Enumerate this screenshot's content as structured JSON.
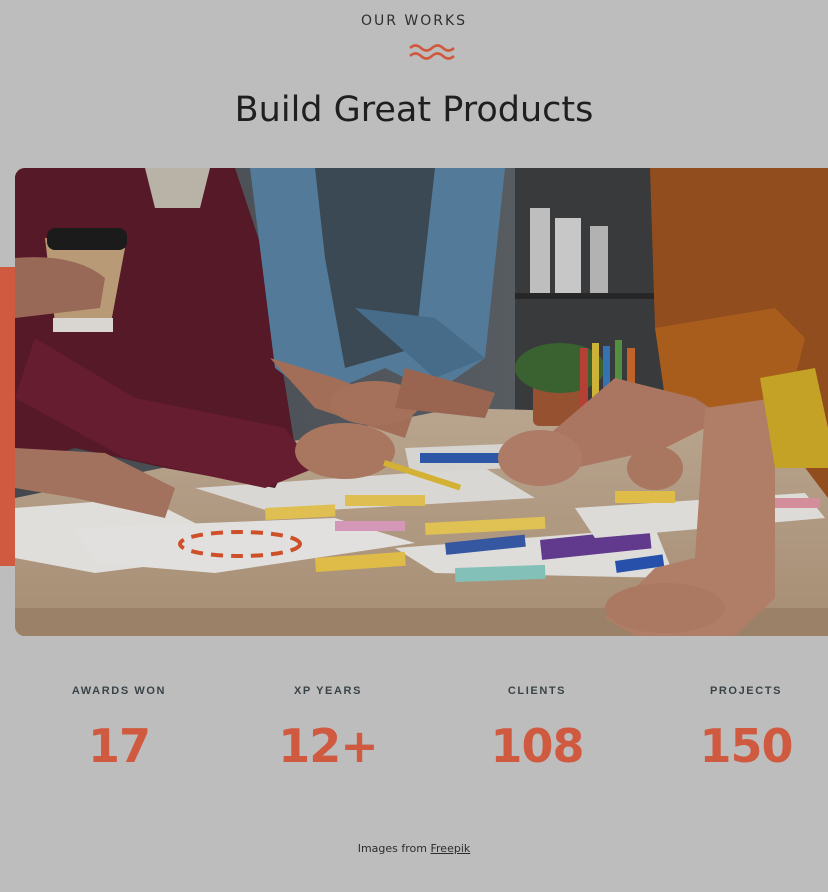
{
  "header": {
    "eyebrow": "OUR WORKS",
    "title": "Build Great Products"
  },
  "accent_color": "#d05a40",
  "hero_image": {
    "description_icon": "team-planning-photo"
  },
  "stats": [
    {
      "label": "AWARDS WON",
      "value": "17"
    },
    {
      "label": "XP YEARS",
      "value": "12+"
    },
    {
      "label": "CLIENTS",
      "value": "108"
    },
    {
      "label": "PROJECTS",
      "value": "150"
    }
  ],
  "footer": {
    "credit_prefix": "Images from",
    "credit_link": "Freepik"
  }
}
